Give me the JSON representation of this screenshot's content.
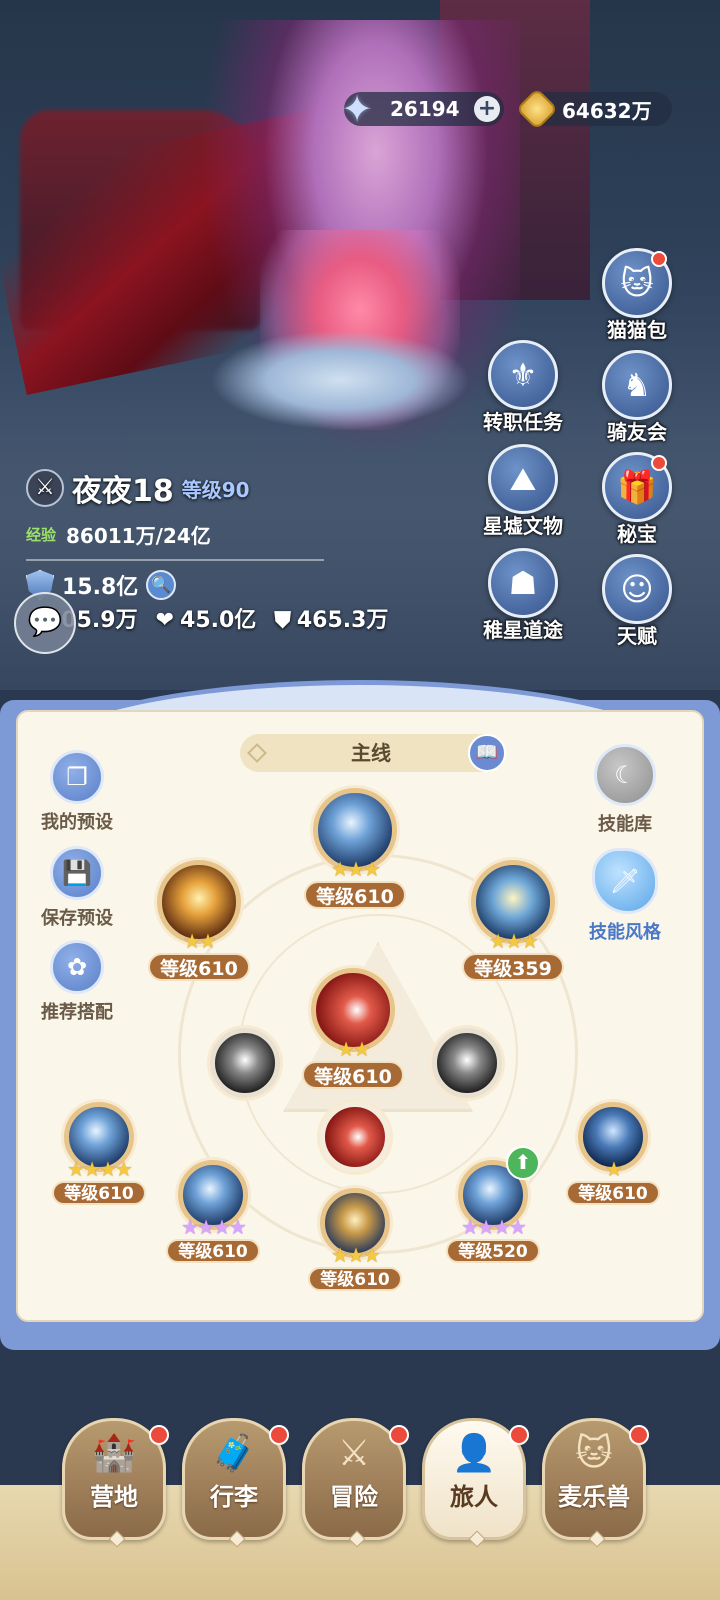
{
  "currency": {
    "gems": "26194",
    "gold": "64632万"
  },
  "side_menu": [
    {
      "key": "cat_bag",
      "label": "猫猫包",
      "icon": "cat-bag-icon",
      "badge": true
    },
    {
      "key": "job_quest",
      "label": "转职任务",
      "icon": "job-quest-icon",
      "badge": false
    },
    {
      "key": "rider_club",
      "label": "骑友会",
      "icon": "horse-icon",
      "badge": false
    },
    {
      "key": "relics",
      "label": "星墟文物",
      "icon": "relic-icon",
      "badge": false
    },
    {
      "key": "treasure",
      "label": "秘宝",
      "icon": "treasure-icon",
      "badge": true
    },
    {
      "key": "path",
      "label": "稚星道途",
      "icon": "path-icon",
      "badge": false
    },
    {
      "key": "talent",
      "label": "天赋",
      "icon": "talent-icon",
      "badge": false
    }
  ],
  "player": {
    "name": "夜夜18",
    "level_label": "等级90",
    "exp_tag": "经验",
    "exp": "86011万/24亿",
    "power": "15.8亿",
    "attack": "705.9万",
    "hp": "45.0亿",
    "defense": "465.3万"
  },
  "panel": {
    "title": "主线",
    "left_buttons": [
      {
        "label": "我的预设",
        "icon": "preset-icon"
      },
      {
        "label": "保存预设",
        "icon": "save-icon"
      },
      {
        "label": "推荐搭配",
        "icon": "recommend-icon"
      }
    ],
    "right_buttons": [
      {
        "label": "技能库",
        "icon": "skill-library-icon"
      },
      {
        "label": "技能风格",
        "icon": "skill-style-icon"
      }
    ],
    "skills": {
      "top": {
        "level": "等级610",
        "stars": 3
      },
      "left_upper": {
        "level": "等级610",
        "stars": 2
      },
      "right_upper": {
        "level": "等级359",
        "stars": 3
      },
      "center": {
        "level": "等级610",
        "stars": 2
      },
      "far_left": {
        "level": "等级610",
        "stars": 4
      },
      "far_right": {
        "level": "等级610",
        "stars": 1
      },
      "bottom_left": {
        "level": "等级610",
        "stars": 4
      },
      "bottom_center": {
        "level": "等级610",
        "stars": 3
      },
      "bottom_right": {
        "level": "等级520",
        "stars": 4
      }
    }
  },
  "nav": [
    {
      "label": "营地",
      "icon": "camp-icon",
      "badge": true,
      "active": false
    },
    {
      "label": "行李",
      "icon": "luggage-icon",
      "badge": true,
      "active": false
    },
    {
      "label": "冒险",
      "icon": "crossed-swords-icon",
      "badge": true,
      "active": false
    },
    {
      "label": "旅人",
      "icon": "traveler-icon",
      "badge": true,
      "active": true
    },
    {
      "label": "麦乐兽",
      "icon": "pet-icon",
      "badge": true,
      "active": false
    }
  ]
}
